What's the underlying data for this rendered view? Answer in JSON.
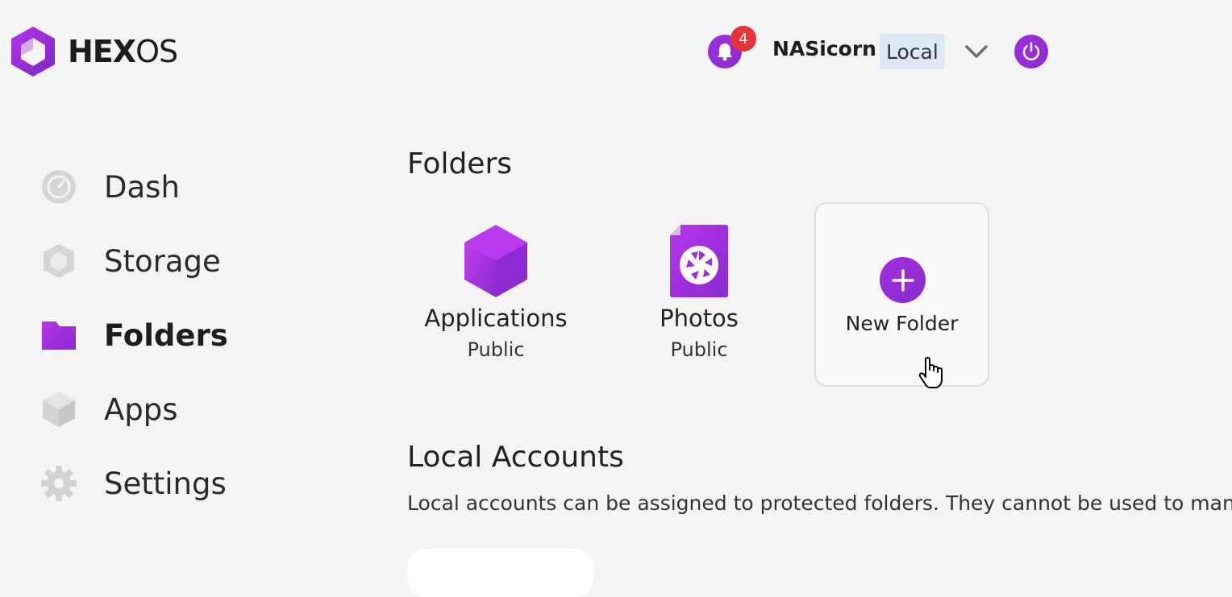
{
  "header": {
    "logo_bold": "HEX",
    "logo_light": "OS",
    "notifications_count": "4",
    "server_name": "NASicorn",
    "server_tag": "Local"
  },
  "sidebar": {
    "items": [
      {
        "label": "Dash",
        "icon": "dash-icon",
        "active": false
      },
      {
        "label": "Storage",
        "icon": "storage-icon",
        "active": false
      },
      {
        "label": "Folders",
        "icon": "folder-icon",
        "active": true
      },
      {
        "label": "Apps",
        "icon": "apps-icon",
        "active": false
      },
      {
        "label": "Settings",
        "icon": "gear-icon",
        "active": false
      }
    ]
  },
  "main": {
    "folders_heading": "Folders",
    "folders": [
      {
        "name": "Applications",
        "visibility": "Public",
        "icon": "cube-icon"
      },
      {
        "name": "Photos",
        "visibility": "Public",
        "icon": "aperture-icon"
      }
    ],
    "new_folder_label": "New Folder",
    "accounts_heading": "Local Accounts",
    "accounts_description": "Local accounts can be assigned to protected folders. They cannot be used to manag"
  },
  "colors": {
    "accent": "#9b2fdc",
    "badge": "#e9333b",
    "tag_bg": "#dce8f6"
  }
}
